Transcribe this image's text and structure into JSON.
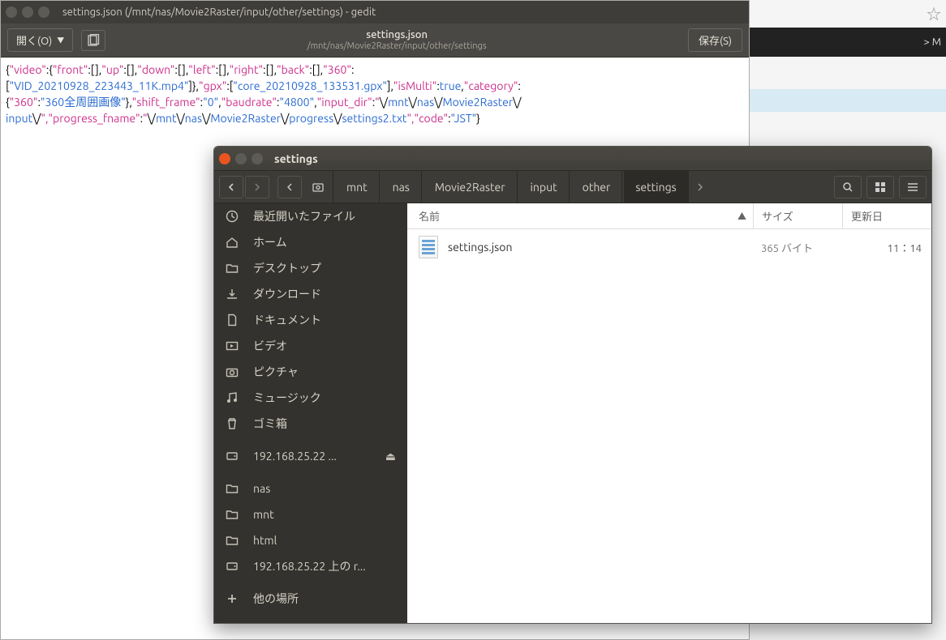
{
  "gedit": {
    "title": "settings.json (/mnt/nas/Movie2Raster/input/other/settings) - gedit",
    "open_label": "開く(O)",
    "filename": "settings.json",
    "filepath": "/mnt/nas/Movie2Raster/input/other/settings",
    "save_label": "保存(S)",
    "json": {
      "t0": "{",
      "t1": "\"video\"",
      "t2": ":{",
      "t3": "\"front\"",
      "t4": ":[],",
      "t5": "\"up\"",
      "t6": ":[],",
      "t7": "\"down\"",
      "t8": ":[],",
      "t9": "\"left\"",
      "t10": ":[],",
      "t11": "\"right\"",
      "t12": ":[],",
      "t13": "\"back\"",
      "t14": ":[],",
      "t15": "\"360\"",
      "t16": ":",
      "t17": "[",
      "t18": "\"VID_20210928_223443_11K.mp4\"",
      "t19": "]},",
      "t20": "\"gpx\"",
      "t21": ":[",
      "t22": "\"core_20210928_133531.gpx\"",
      "t23": "],",
      "t24": "\"isMulti\"",
      "t25": ":",
      "t26": "true",
      "t27": ",",
      "t28": "\"category\"",
      "t29": ":",
      "t30": "{",
      "t31": "\"360\"",
      "t32": ":",
      "t33": "\"360全周囲画像\"",
      "t34": "},",
      "t35": "\"shift_frame\"",
      "t36": ":",
      "t37": "\"0\"",
      "t38": ",",
      "t39": "\"baudrate\"",
      "t40": ":",
      "t41": "\"4800\"",
      "t42": ",",
      "t43": "\"input_dir\"",
      "t44": ":",
      "t45": "\"",
      "t46": "\\/",
      "t47": "mnt",
      "t48": "\\/",
      "t49": "nas",
      "t50": "\\/",
      "t51": "Movie2Raster",
      "t52": "\\/",
      "t53": "input",
      "t54": "\\/",
      "t55": "\",",
      "t56": "\"progress_fname\"",
      "t57": ":",
      "t58": "\"",
      "t59": "\\/",
      "t60": "mnt",
      "t61": "\\/",
      "t62": "nas",
      "t63": "\\/",
      "t64": "Movie2Raster",
      "t65": "\\/",
      "t66": "progress",
      "t67": "\\/",
      "t68": "settings2.txt",
      "t69": "\",",
      "t70": "\"code\"",
      "t71": ":",
      "t72": "\"JST\"",
      "t73": "}"
    }
  },
  "right": {
    "dark_text": "> M"
  },
  "nautilus": {
    "title": "settings",
    "breadcrumbs": [
      "mnt",
      "nas",
      "Movie2Raster",
      "input",
      "other",
      "settings"
    ],
    "sidebar": [
      {
        "icon": "clock",
        "label": "最近開いたファイル"
      },
      {
        "icon": "home",
        "label": "ホーム"
      },
      {
        "icon": "folder",
        "label": "デスクトップ"
      },
      {
        "icon": "download",
        "label": "ダウンロード"
      },
      {
        "icon": "doc",
        "label": "ドキュメント"
      },
      {
        "icon": "video",
        "label": "ビデオ"
      },
      {
        "icon": "camera",
        "label": "ピクチャ"
      },
      {
        "icon": "music",
        "label": "ミュージック"
      },
      {
        "icon": "trash",
        "label": "ゴミ箱"
      }
    ],
    "sidebar2": [
      {
        "icon": "disk",
        "label": "192.168.25.22 ...",
        "eject": true
      }
    ],
    "sidebar3": [
      {
        "icon": "folder",
        "label": "nas"
      },
      {
        "icon": "folder",
        "label": "mnt"
      },
      {
        "icon": "folder",
        "label": "html"
      },
      {
        "icon": "disk",
        "label": "192.168.25.22 上の r..."
      }
    ],
    "sidebar4": [
      {
        "icon": "plus",
        "label": "他の場所"
      }
    ],
    "columns": {
      "name": "名前",
      "size": "サイズ",
      "date": "更新日"
    },
    "files": [
      {
        "name": "settings.json",
        "size": "365 バイト",
        "date": "11：14"
      }
    ]
  }
}
